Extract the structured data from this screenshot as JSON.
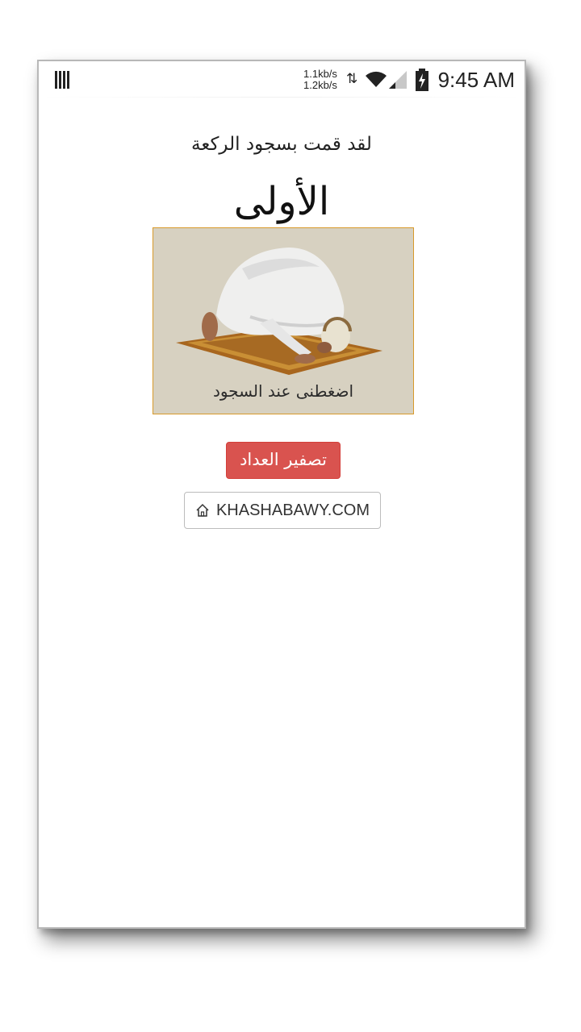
{
  "status_bar": {
    "speed_up": "1.1kb/s",
    "speed_down": "1.2kb/s",
    "time": "9:45 AM",
    "icons": [
      "notification-icon",
      "data-arrows-icon",
      "wifi-icon",
      "signal-icon",
      "battery-charging-icon"
    ]
  },
  "main": {
    "message": "لقد قمت بسجود الركعة",
    "rakaa_name": "الأولى",
    "card": {
      "image": "prostrating-man-on-prayer-rug",
      "label": "اضغطنى عند السجود",
      "background": "#d7d1c1",
      "border_color": "#d89a2b"
    },
    "reset_button": "تصفير العداد",
    "site_button": "KHASHABAWY.COM"
  },
  "colors": {
    "reset": "#d9534f",
    "text": "#222222"
  }
}
